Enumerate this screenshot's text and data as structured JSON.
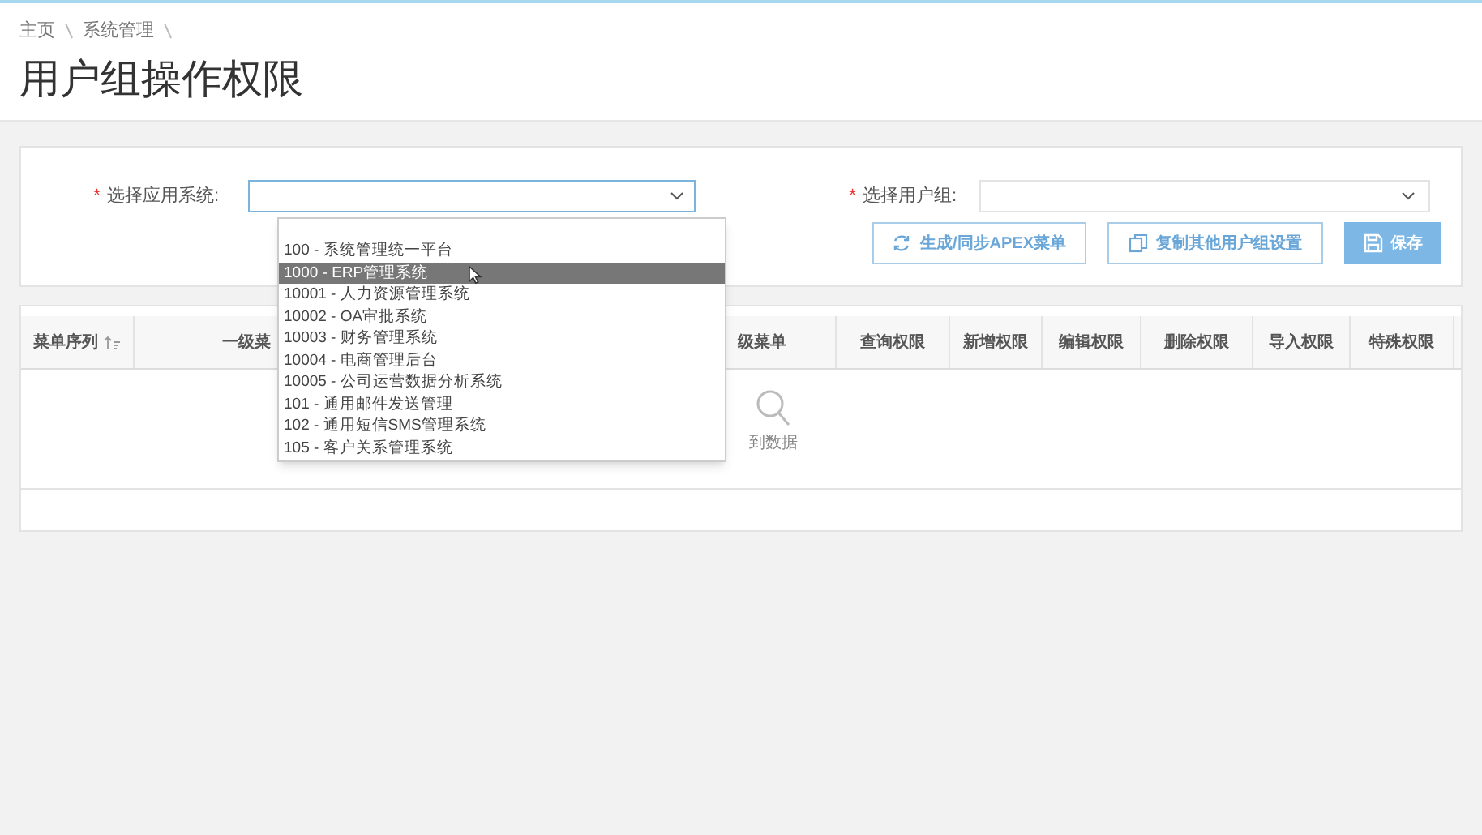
{
  "breadcrumb": [
    "主页",
    "系统管理"
  ],
  "page_title": "用户组操作权限",
  "form": {
    "app_system": {
      "label": "选择应用系统:",
      "required_mark": "*"
    },
    "user_group": {
      "label": "选择用户组:",
      "required_mark": "*"
    }
  },
  "buttons": [
    {
      "kind": "outline",
      "label": "生成/同步APEX菜单"
    },
    {
      "kind": "outline",
      "label": "复制其他用户组设置"
    },
    {
      "kind": "primary",
      "label": "保存"
    }
  ],
  "table": {
    "columns": [
      {
        "label": "菜单序列",
        "sortable": true
      },
      {
        "label": "一级菜",
        "sortable": false
      },
      {
        "label": "级菜单",
        "sortable": false
      },
      {
        "label": "查询权限",
        "sortable": false
      },
      {
        "label": "新增权限",
        "sortable": false
      },
      {
        "label": "编辑权限",
        "sortable": false
      },
      {
        "label": "删除权限",
        "sortable": false
      },
      {
        "label": "导入权限",
        "sortable": false
      },
      {
        "label": "特殊权限",
        "sortable": false
      }
    ],
    "empty_text": "到数据"
  },
  "dropdown": {
    "options": [
      {
        "label": "100 - 系统管理统一平台",
        "selected": false
      },
      {
        "label": "1000 - ERP管理系统",
        "selected": true
      },
      {
        "label": "10001 - 人力资源管理系统",
        "selected": false
      },
      {
        "label": "10002 - OA审批系统",
        "selected": false
      },
      {
        "label": "10003 - 财务管理系统",
        "selected": false
      },
      {
        "label": "10004 - 电商管理后台",
        "selected": false
      },
      {
        "label": "10005 - 公司运营数据分析系统",
        "selected": false
      },
      {
        "label": "101 - 通用邮件发送管理",
        "selected": false
      },
      {
        "label": "102 - 通用短信SMS管理系统",
        "selected": false
      },
      {
        "label": "105 - 客户关系管理系统",
        "selected": false
      }
    ]
  }
}
